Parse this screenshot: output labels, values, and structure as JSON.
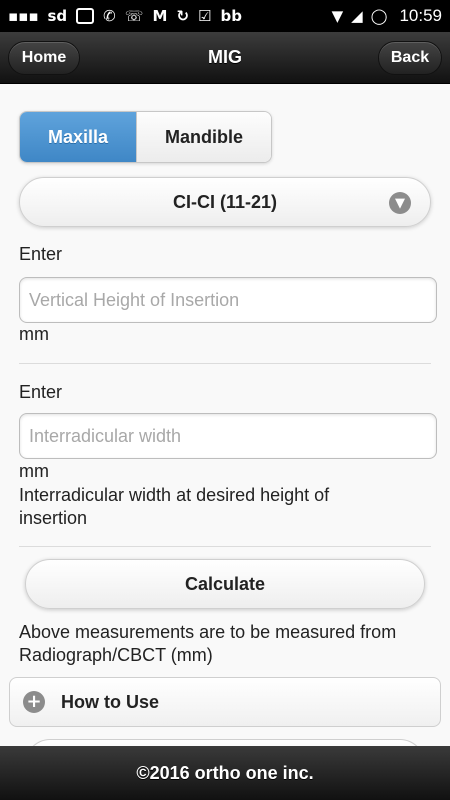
{
  "statusbar": {
    "icons": [
      "menu-dots-icon",
      "sd-card-icon",
      "gallery-icon",
      "whatsapp-icon",
      "missed-call-icon",
      "gmail-icon",
      "sync-icon",
      "checkbox-icon",
      "bbm-icon",
      "wifi-icon",
      "signal-icon",
      "alarm-icon"
    ],
    "sd_text": "sd",
    "bb_text": "bb",
    "time": "10:59"
  },
  "header": {
    "title": "MIG",
    "home_label": "Home",
    "back_label": "Back"
  },
  "jaw": {
    "options": [
      "Maxilla",
      "Mandible"
    ],
    "selected": "Maxilla"
  },
  "tooth_select": {
    "value": "CI-CI (11-21)",
    "icon": "chevron-down-icon"
  },
  "height_field": {
    "label": "Enter",
    "placeholder": "Vertical Height of Insertion",
    "value": "",
    "unit": "mm"
  },
  "width_field": {
    "label": "Enter",
    "placeholder": "Interradicular width",
    "value": "",
    "unit": "mm",
    "hint": "Interradicular width at desired height of insertion"
  },
  "calculate_label": "Calculate",
  "note": "Above measurements are to be measured from Radiograph/CBCT (mm)",
  "how_to_use": {
    "label": "How to Use",
    "icon": "plus-icon"
  },
  "footer": {
    "text": "©2016 ortho one inc."
  },
  "colors": {
    "accent": "#4a90d0",
    "bar": "#1a1a1a"
  }
}
